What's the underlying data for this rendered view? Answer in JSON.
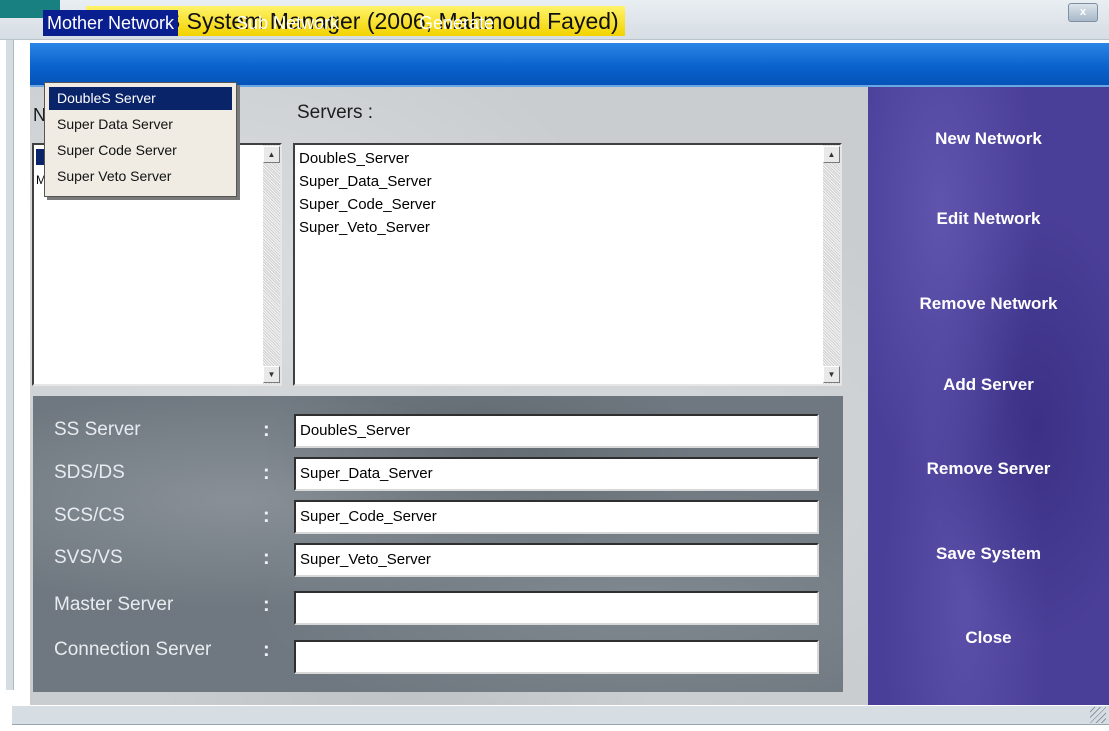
{
  "window": {
    "title": "DoubleS System Manager (2006, Mahmoud Fayed)",
    "close_glyph": "x"
  },
  "menu": {
    "items": [
      "Mother Network",
      "Sub Network",
      "Generate"
    ],
    "selected": "Mother Network"
  },
  "dropdown": {
    "items": [
      "DoubleS Server",
      "Super Data Server",
      "Super Code Server",
      "Super Veto Server"
    ],
    "selected": "DoubleS Server"
  },
  "networks": {
    "label_fragment": "N",
    "selected_marker": "M",
    "second_marker": "M"
  },
  "servers": {
    "label": "Servers :",
    "items": [
      "DoubleS_Server",
      "Super_Data_Server",
      "Super_Code_Server",
      "Super_Veto_Server"
    ]
  },
  "fields": [
    {
      "label": "SS Server",
      "colon": ":",
      "value": "DoubleS_Server"
    },
    {
      "label": "SDS/DS",
      "colon": ":",
      "value": "Super_Data_Server"
    },
    {
      "label": "SCS/CS",
      "colon": ":",
      "value": "Super_Code_Server"
    },
    {
      "label": "SVS/VS",
      "colon": ":",
      "value": "Super_Veto_Server"
    },
    {
      "label": "Master Server",
      "colon": ":",
      "value": ""
    },
    {
      "label": "Connection Server",
      "colon": ":",
      "value": ""
    }
  ],
  "actions": [
    "New Network",
    "Edit Network",
    "Remove Network",
    "Add Server",
    "Remove Server",
    "Save System",
    "Close"
  ],
  "colors": {
    "menu_blue": "#0a63cc",
    "selection_navy": "#0a246a",
    "side_panel_purple": "#4a3f98",
    "title_highlight": "#f2d200"
  }
}
